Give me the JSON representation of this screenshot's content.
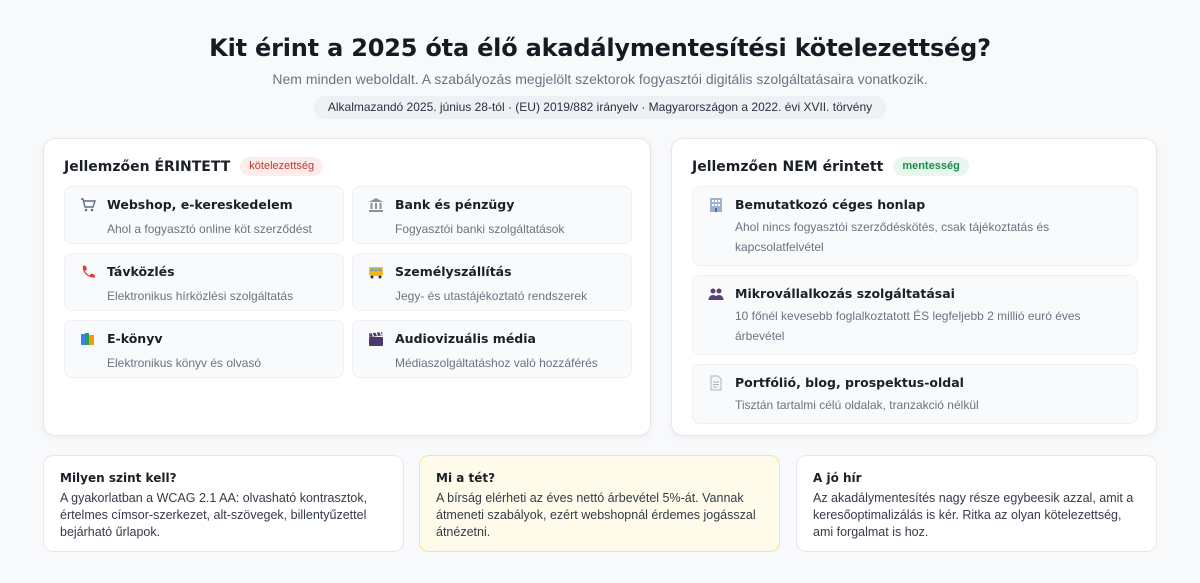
{
  "header": {
    "title": "Kit érint a 2025 óta élő akadálymentesítési kötelezettség?",
    "subtitle": "Nem minden weboldalt. A szabályozás megjelölt szektorok fogyasztói digitális szolgáltatásaira vonatkozik.",
    "pill": "Alkalmazandó 2025. június 28-tól · (EU) 2019/882 irányelv · Magyarországon a 2022. évi XVII. törvény"
  },
  "affected": {
    "title": "Jellemzően ÉRINTETT",
    "badge": "kötelezettség",
    "items": [
      {
        "icon": "shopping-cart-icon",
        "title": "Webshop, e-kereskedelem",
        "desc": "Ahol a fogyasztó online köt szerződést"
      },
      {
        "icon": "bank-icon",
        "title": "Bank és pénzügy",
        "desc": "Fogyasztói banki szolgáltatások"
      },
      {
        "icon": "telephone-icon",
        "title": "Távközlés",
        "desc": "Elektronikus hírközlési szolgáltatás"
      },
      {
        "icon": "bus-icon",
        "title": "Személyszállítás",
        "desc": "Jegy- és utastájékoztató rendszerek"
      },
      {
        "icon": "books-icon",
        "title": "E-könyv",
        "desc": "Elektronikus könyv és olvasó"
      },
      {
        "icon": "clapperboard-icon",
        "title": "Audiovizuális média",
        "desc": "Médiaszolgáltatáshoz való hozzáférés"
      }
    ]
  },
  "exempt": {
    "title": "Jellemzően NEM érintett",
    "badge": "mentesség",
    "items": [
      {
        "icon": "office-building-icon",
        "title": "Bemutatkozó céges honlap",
        "desc": "Ahol nincs fogyasztói szerződéskötés, csak tájékoztatás és kapcsolatfelvétel"
      },
      {
        "icon": "people-icon",
        "title": "Mikrovállalkozás szolgáltatásai",
        "desc": "10 főnél kevesebb foglalkoztatott ÉS legfeljebb 2 millió euró éves árbevétel"
      },
      {
        "icon": "document-icon",
        "title": "Portfólió, blog, prospektus-oldal",
        "desc": "Tisztán tartalmi célú oldalak, tranzakció nélkül"
      }
    ]
  },
  "cards": [
    {
      "title": "Milyen szint kell?",
      "text": "A gyakorlatban a WCAG 2.1 AA: olvasható kontrasztok, értelmes címsor-szerkezet, alt-szövegek, billentyűzettel bejárható űrlapok."
    },
    {
      "title": "Mi a tét?",
      "text": "A bírság elérheti az éves nettó árbevétel 5%-át. Vannak átmeneti szabályok, ezért webshopnál érdemes jogásszal átnézetni."
    },
    {
      "title": "A jó hír",
      "text": "Az akadálymentesítés nagy része egybeesik azzal, amit a keresőoptimalizálás is kér. Ritka az olyan kötelezettség, ami forgalmat is hoz."
    }
  ],
  "colors": {
    "badge_red": "#c0392b",
    "badge_green": "#1e8a4c",
    "highlight_card": "#fffbea"
  }
}
